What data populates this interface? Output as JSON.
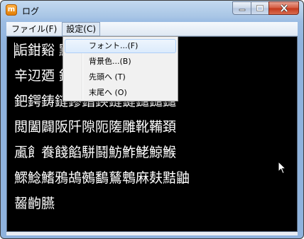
{
  "window": {
    "title": "ログ",
    "app_icon_letter": "m"
  },
  "menubar": {
    "items": [
      {
        "label": "ファイル(F)"
      },
      {
        "label": "設定(C)"
      }
    ]
  },
  "settings_menu": {
    "items": [
      {
        "label": "フォント...(F)"
      },
      {
        "label": "背景色...(B)"
      },
      {
        "label": "先頭へ (T)"
      },
      {
        "label": "末尾へ (O)"
      }
    ]
  },
  "log": {
    "lines": [
      "詬鉗谿                 黥鰥輞",
      "辛辺廼                 鋏鉠鈾",
      "鈀鍔鋳鏈鏐鍇鍈鏈鍵鑓鑓鑓",
      "閲闔闢阪阡隙阨隓雕靴鞴頚",
      "颪飠飬餞餡駢鬪魴鮓鮱鯨鯸",
      "鰥鯰鰭鴉鴣鵺鷭鶿鵯麻麸黠鼬",
      "齧齣臙"
    ]
  }
}
